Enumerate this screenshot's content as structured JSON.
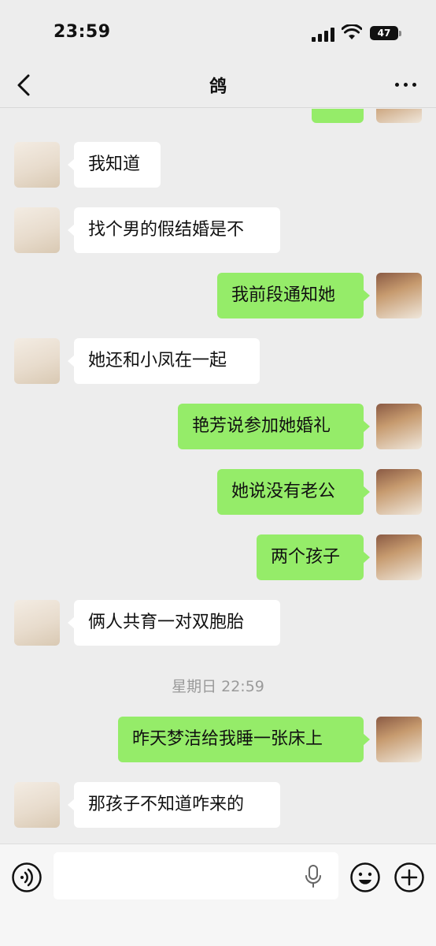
{
  "status_bar": {
    "time": "23:59",
    "battery": "47"
  },
  "nav": {
    "title": "鸽"
  },
  "messages": [
    {
      "side": "in",
      "text": "我知道"
    },
    {
      "side": "in",
      "text": "找个男的假结婚是不"
    },
    {
      "side": "out",
      "text": "我前段通知她"
    },
    {
      "side": "in",
      "text": "她还和小凤在一起"
    },
    {
      "side": "out",
      "text": "艳芳说参加她婚礼"
    },
    {
      "side": "out",
      "text": "她说没有老公"
    },
    {
      "side": "out",
      "text": "两个孩子"
    },
    {
      "side": "in",
      "text": "俩人共育一对双胞胎"
    },
    {
      "side": "time",
      "text": "星期日 22:59"
    },
    {
      "side": "out",
      "text": "昨天梦洁给我睡一张床上"
    },
    {
      "side": "in",
      "text": "那孩子不知道咋来的"
    }
  ],
  "input": {
    "value": ""
  },
  "colors": {
    "bubble_out": "#95ec69",
    "bubble_in": "#ffffff",
    "background": "#ededed"
  },
  "icons": {
    "back": "chevron-left-icon",
    "more": "ellipsis-icon",
    "voice": "voice-icon",
    "mic": "mic-icon",
    "emoji": "emoji-icon",
    "plus": "plus-icon"
  }
}
